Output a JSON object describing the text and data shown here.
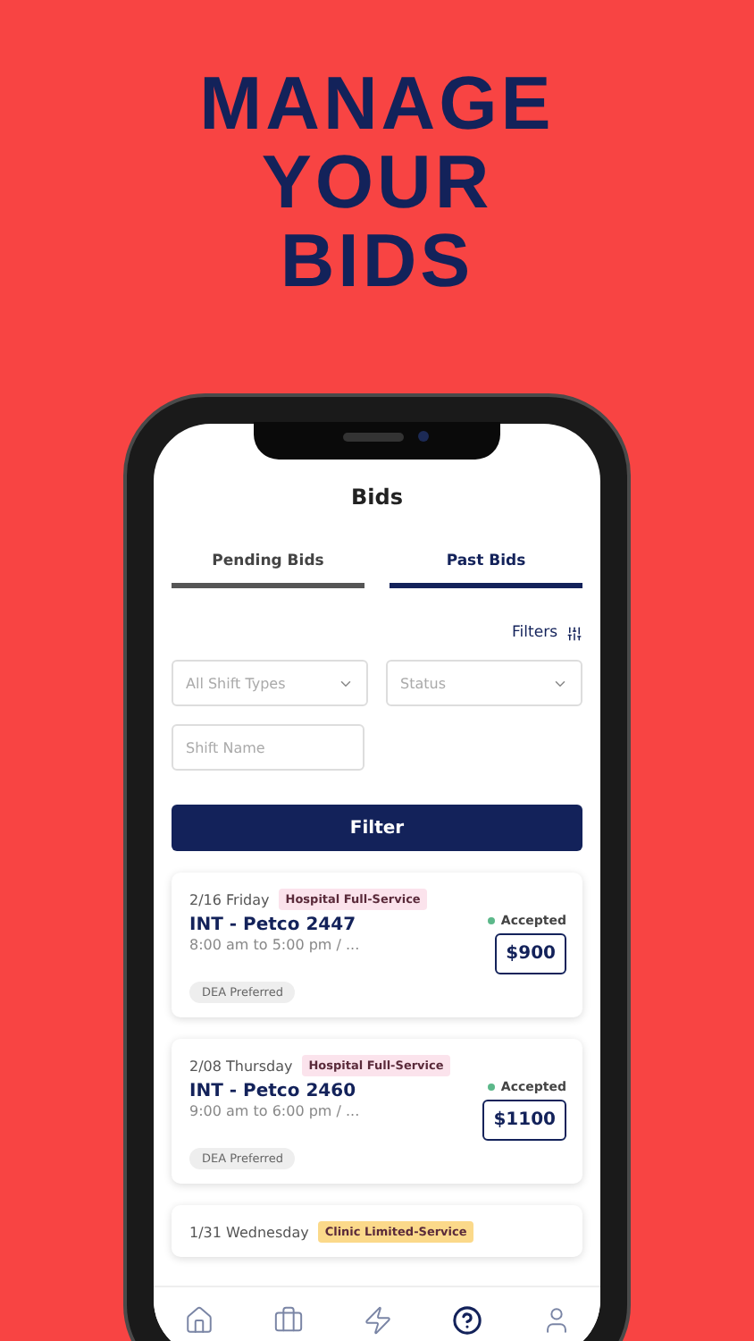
{
  "headline": [
    "MANAGE",
    "YOUR",
    "BIDS"
  ],
  "screen_title": "Bids",
  "tabs": [
    {
      "label": "Pending Bids",
      "selected": false
    },
    {
      "label": "Past Bids",
      "selected": true
    }
  ],
  "filters_link": "Filters",
  "dropdowns": [
    {
      "placeholder": "All Shift Types"
    },
    {
      "placeholder": "Status"
    }
  ],
  "shift_name": {
    "placeholder": "Shift Name"
  },
  "filter_button": "Filter",
  "bids": [
    {
      "date": "2/16 Friday",
      "type": "Hospital Full-Service",
      "color": "#fbe3ec",
      "title": "INT - Petco 2447",
      "time": "8:00 am to 5:00 pm / ...",
      "status": "Accepted",
      "amount": "$900",
      "tag": "DEA Preferred"
    },
    {
      "date": "2/08 Thursday",
      "type": "Hospital Full-Service",
      "color": "#fbe3ec",
      "title": "INT - Petco 2460",
      "time": "9:00 am to 6:00 pm / ...",
      "status": "Accepted",
      "amount": "$1100",
      "tag": "DEA Preferred"
    },
    {
      "date": "1/31 Wednesday",
      "type": "Clinic Limited-Service",
      "color": "#fbd98a"
    }
  ],
  "nav": [
    {
      "kind": "home",
      "selected": false
    },
    {
      "kind": "briefcase",
      "selected": false
    },
    {
      "kind": "bolt",
      "selected": false
    },
    {
      "kind": "help",
      "selected": true
    },
    {
      "kind": "user",
      "selected": false
    }
  ]
}
